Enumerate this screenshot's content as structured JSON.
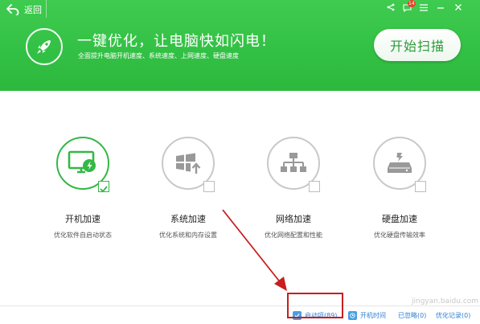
{
  "header": {
    "back_label": "返回",
    "notification_count": "14",
    "headline": "一键优化，让电脑快如闪电！",
    "subline": "全面提升电脑开机速度、系统速度、上网速度、硬盘速度",
    "start_button": "开始扫描",
    "colors": {
      "green": "#33c145",
      "button_text": "#2a9a38"
    },
    "icons": [
      "back-arrow-icon",
      "share-icon",
      "message-icon",
      "menu-icon",
      "minimize-icon",
      "close-icon",
      "rocket-icon"
    ]
  },
  "options": [
    {
      "label": "开机加速",
      "description": "优化软件自启动状态",
      "icon": "monitor-lightning-icon",
      "checked": true
    },
    {
      "label": "系统加速",
      "description": "优化系统和内存设置",
      "icon": "windows-arrow-icon",
      "checked": false
    },
    {
      "label": "网络加速",
      "description": "优化网络配置和性能",
      "icon": "network-icon",
      "checked": false
    },
    {
      "label": "硬盘加速",
      "description": "优化硬盘传输效率",
      "icon": "harddisk-icon",
      "checked": false
    }
  ],
  "footer": {
    "startup_items": "启动项(89)",
    "boot_time": "开机时间",
    "ignored": "已忽略(0)",
    "history": "优化记录(0)"
  },
  "annotation": {
    "arrow_color": "#c81e1e"
  },
  "watermark": "jingyan.baidu.com"
}
